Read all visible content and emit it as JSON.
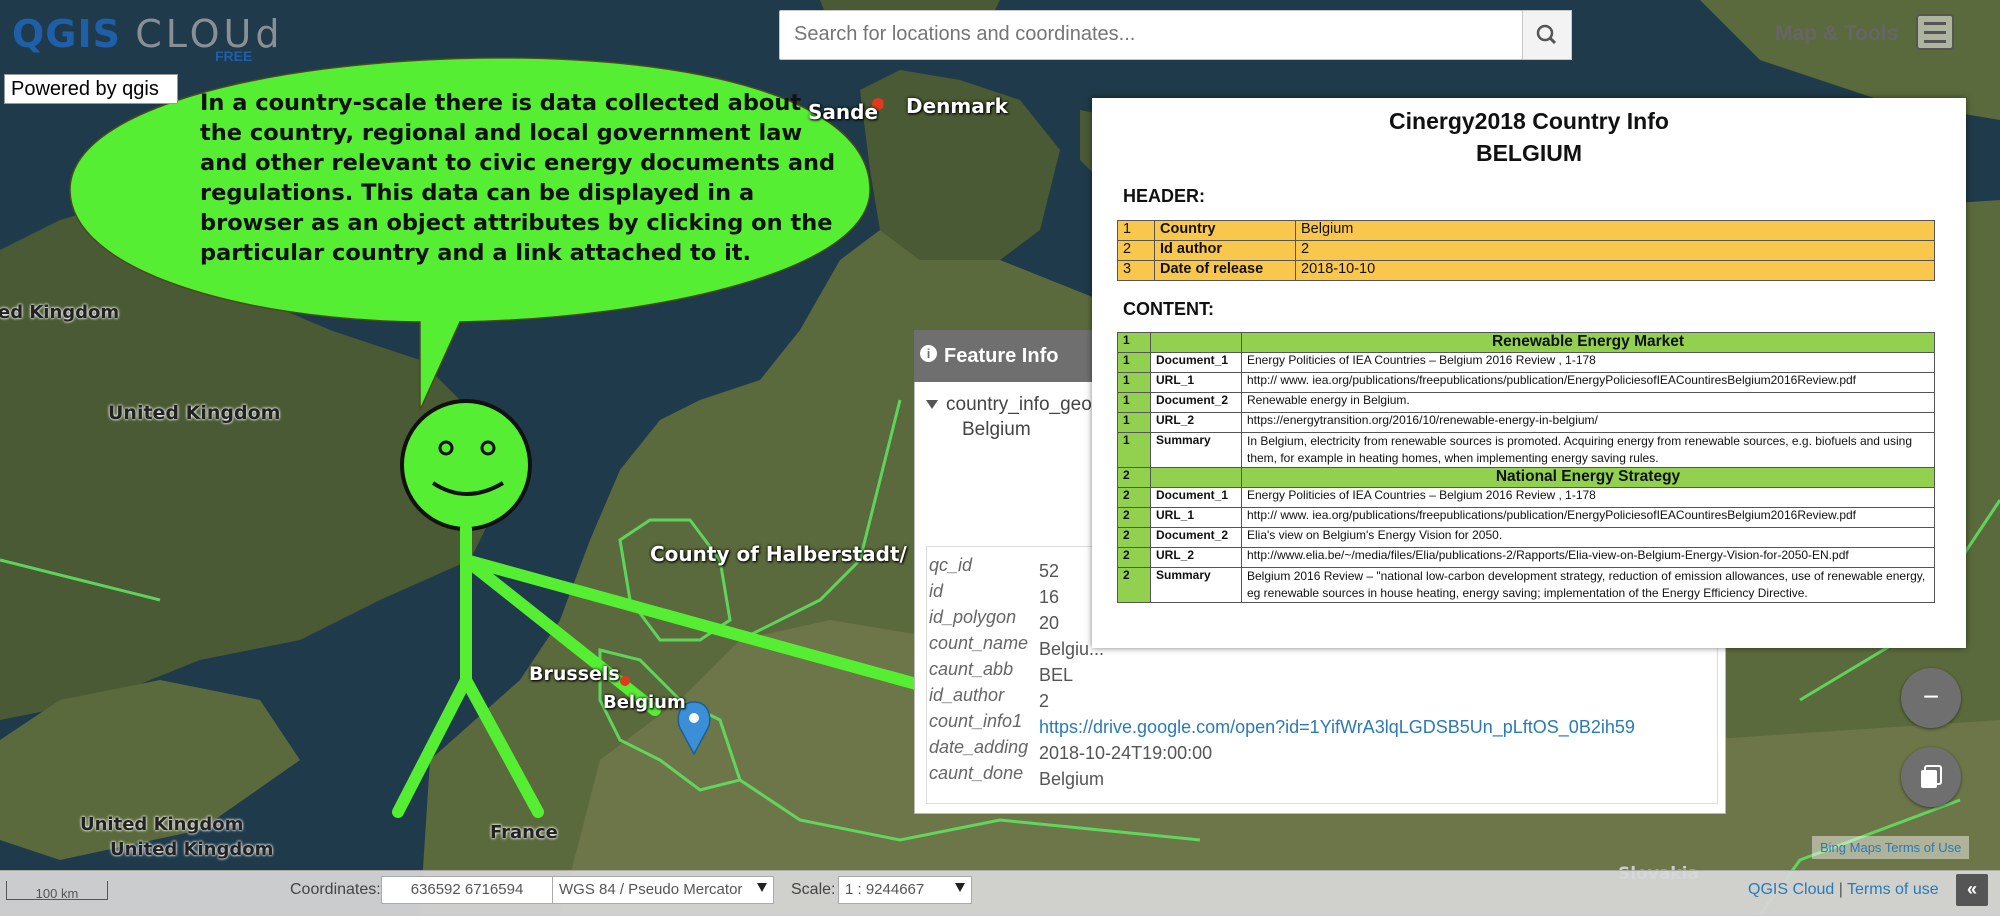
{
  "app": {
    "logo_main": "QGIS",
    "logo_cloud": "CLOUd",
    "logo_sub": "FREE",
    "powered_by": "Powered by qgis"
  },
  "search": {
    "placeholder": "Search for locations and coordinates..."
  },
  "header": {
    "map_tools_label": "Map & Tools"
  },
  "icons": {
    "search": "search-icon",
    "menu": "hamburger-menu-icon",
    "info": "info-icon",
    "marker": "map-marker-icon",
    "zoom_out": "minus-icon",
    "layers": "layers-icon",
    "collapse": "double-chevron-left-icon"
  },
  "annotation": {
    "bubble_text": "In a country-scale there is data collected about the country, regional and local government law and other relevant to civic energy documents and regulations. This data can be displayed in a browser as an object attributes by clicking on the particular country and a link attached to it."
  },
  "map_labels": {
    "denmark": "Denmark",
    "sande": "Sande",
    "kingdom_cut": "ed Kingdom",
    "uk_1": "United Kingdom",
    "county": "County of Halberstadt/",
    "brussels": "Brussels",
    "belgium": "Belgium",
    "uk_2": "United Kingdom",
    "uk_3": "United Kingdom",
    "france": "France",
    "slovakia": "Slovakia"
  },
  "feature_info": {
    "title": "Feature Info",
    "layer_name": "country_info_geo",
    "feature_name": "Belgium",
    "attributes": [
      {
        "key": "qc_id",
        "value": "52"
      },
      {
        "key": "id",
        "value": "16"
      },
      {
        "key": "id_polygon",
        "value": "20"
      },
      {
        "key": "count_name",
        "value": "Belgiu..."
      },
      {
        "key": "caunt_abb",
        "value": "BEL"
      },
      {
        "key": "id_author",
        "value": "2"
      },
      {
        "key": "count_info1",
        "value": "https://drive.google.com/open?id=1YifWrA3lqLGDSB5Un_pLftOS_0B2ih59"
      },
      {
        "key": "date_adding",
        "value": "2018-10-24T19:00:00"
      },
      {
        "key": "caunt_done",
        "value": "Belgium"
      }
    ]
  },
  "doc": {
    "title": "Cinergy2018 Country Info",
    "country": "BELGIUM",
    "header_label": "HEADER:",
    "content_label": "CONTENT:",
    "header_rows": [
      {
        "n": "1",
        "k": "Country",
        "v": "Belgium"
      },
      {
        "n": "2",
        "k": "Id author",
        "v": "2"
      },
      {
        "n": "3",
        "k": "Date of release",
        "v": "2018-10-10"
      }
    ],
    "sections": [
      {
        "n": "1",
        "title": "Renewable Energy Market",
        "rows": [
          {
            "n": "1",
            "k": "Document_1",
            "v": "Energy Politicies of IEA Countries – Belgium 2016 Review , 1-178"
          },
          {
            "n": "1",
            "k": "URL_1",
            "v": "http:// www. iea.org/publications/freepublications/publication/EnergyPoliciesofIEACountiresBelgium2016Review.pdf"
          },
          {
            "n": "1",
            "k": "Document_2",
            "v": "Renewable energy in Belgium."
          },
          {
            "n": "1",
            "k": "URL_2",
            "v": "https://energytransition.org/2016/10/renewable-energy-in-belgium/"
          },
          {
            "n": "1",
            "k": "Summary",
            "v": "In Belgium, electricity from renewable sources is promoted. Acquiring energy from renewable sources, e.g. biofuels and using them, for example in heating homes, when implementing energy saving rules."
          }
        ]
      },
      {
        "n": "2",
        "title": "National Energy Strategy",
        "rows": [
          {
            "n": "2",
            "k": "Document_1",
            "v": "Energy Politicies of IEA Countries – Belgium 2016 Review , 1-178"
          },
          {
            "n": "2",
            "k": "URL_1",
            "v": "http:// www. iea.org/publications/freepublications/publication/EnergyPoliciesofIEACountiresBelgium2016Review.pdf"
          },
          {
            "n": "2",
            "k": "Document_2",
            "v": "Elia's view on Belgium's Energy Vision for 2050."
          },
          {
            "n": "2",
            "k": "URL_2",
            "v": "http://www.elia.be/~/media/files/Elia/publications-2/Rapports/Elia-view-on-Belgium-Energy-Vision-for-2050-EN.pdf"
          },
          {
            "n": "2",
            "k": "Summary",
            "v": "Belgium 2016 Review – \"national low-carbon development strategy, reduction of emission allowances, use of renewable energy, eg renewable sources in house heating, energy saving; implementation of the Energy Efficiency Directive."
          }
        ]
      }
    ]
  },
  "controls": {
    "zoom_out": "−"
  },
  "footer": {
    "scale_label": "100 km",
    "coordinates_label": "Coordinates:",
    "coordinates_value": "636592 6716594",
    "crs_value": "WGS 84 / Pseudo Mercator",
    "scale_text_label": "Scale:",
    "scale_value": "1 : 9244667",
    "link_qgis": "QGIS Cloud",
    "link_terms": "Terms of use",
    "separator": "|",
    "collapse": "«",
    "bing_terms": "Bing Maps Terms of Use"
  },
  "colors": {
    "annotation_green": "#55ee33",
    "link": "#2a7ab8",
    "header_yellow": "#f9c74b",
    "content_green": "#92d050",
    "panel_gray": "#6f6f6f"
  }
}
